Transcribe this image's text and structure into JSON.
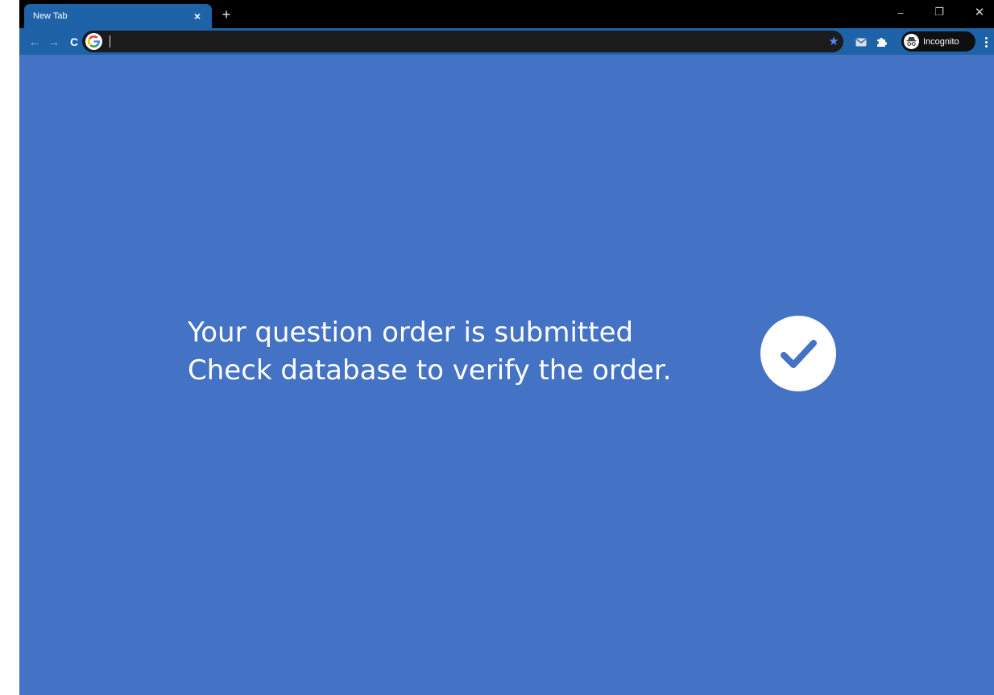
{
  "browser": {
    "tab": {
      "title": "New Tab",
      "close_glyph": "×"
    },
    "new_tab_glyph": "+",
    "window_controls": {
      "minimize": "–",
      "restore": "❐",
      "close": "✕"
    },
    "nav": {
      "back": "←",
      "forward": "→",
      "reload": "C"
    },
    "omnibox": {
      "value": "",
      "bookmark_glyph": "★"
    },
    "profile": {
      "label": "Incognito"
    },
    "theme": {
      "tab_bar": "#000000",
      "toolbar": "#1e62a8",
      "omnibox": "#1b1b1b"
    }
  },
  "page": {
    "background": "#4472c4",
    "message_line1": "Your question order is submitted",
    "message_line2": "Check database to verify the order.",
    "status_icon": "checkmark-circle-icon"
  }
}
